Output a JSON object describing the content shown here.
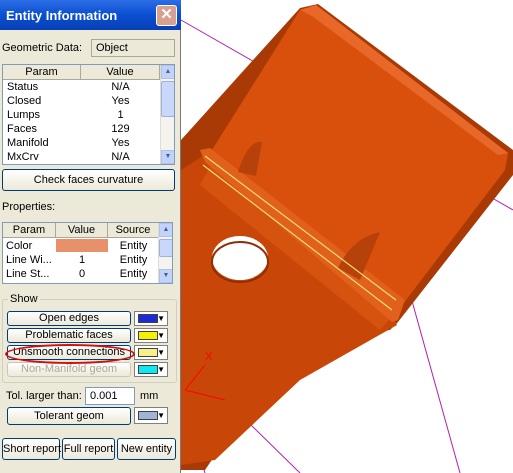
{
  "window": {
    "title": "Entity Information",
    "close_glyph": "✕"
  },
  "geometric": {
    "label": "Geometric Data:",
    "value": "Object"
  },
  "params_table": {
    "headers": [
      "Param",
      "Value"
    ],
    "rows": [
      [
        "Status",
        "N/A"
      ],
      [
        "Closed",
        "Yes"
      ],
      [
        "Lumps",
        "1"
      ],
      [
        "Faces",
        "129"
      ],
      [
        "Manifold",
        "Yes"
      ],
      [
        "MxCrv",
        "N/A"
      ]
    ]
  },
  "check_faces_button": "Check faces curvature",
  "properties": {
    "label": "Properties:",
    "headers": [
      "Param",
      "Value",
      "Source"
    ],
    "rows": [
      {
        "param": "Color",
        "value": "",
        "source": "Entity",
        "swatch": "#e8906a"
      },
      {
        "param": "Line Wi...",
        "value": "1",
        "source": "Entity"
      },
      {
        "param": "Line St...",
        "value": "0",
        "source": "Entity"
      }
    ]
  },
  "show": {
    "label": "Show",
    "items": [
      {
        "label": "Open edges",
        "color": "#1c2ad8",
        "enabled": true
      },
      {
        "label": "Problematic faces",
        "color": "#f5f000",
        "enabled": true
      },
      {
        "label": "Unsmooth connections",
        "color": "#f6ef8a",
        "enabled": true
      },
      {
        "label": "Non-Manifold geom",
        "color": "#10e8f0",
        "enabled": false
      }
    ]
  },
  "tolerance": {
    "label": "Tol. larger than:",
    "value": "0.001",
    "unit": "mm"
  },
  "tolerant_geom": {
    "label": "Tolerant geom",
    "color": "#a0b4d8"
  },
  "bottom_buttons": [
    "Short report",
    "Full report",
    "New entity"
  ],
  "colors": {
    "part": "#d94a08",
    "part_edge": "#a63400",
    "guide_lines": "#b020b0",
    "seam": "#f0e070",
    "axis": "#ff0000"
  },
  "axis_label": "X"
}
